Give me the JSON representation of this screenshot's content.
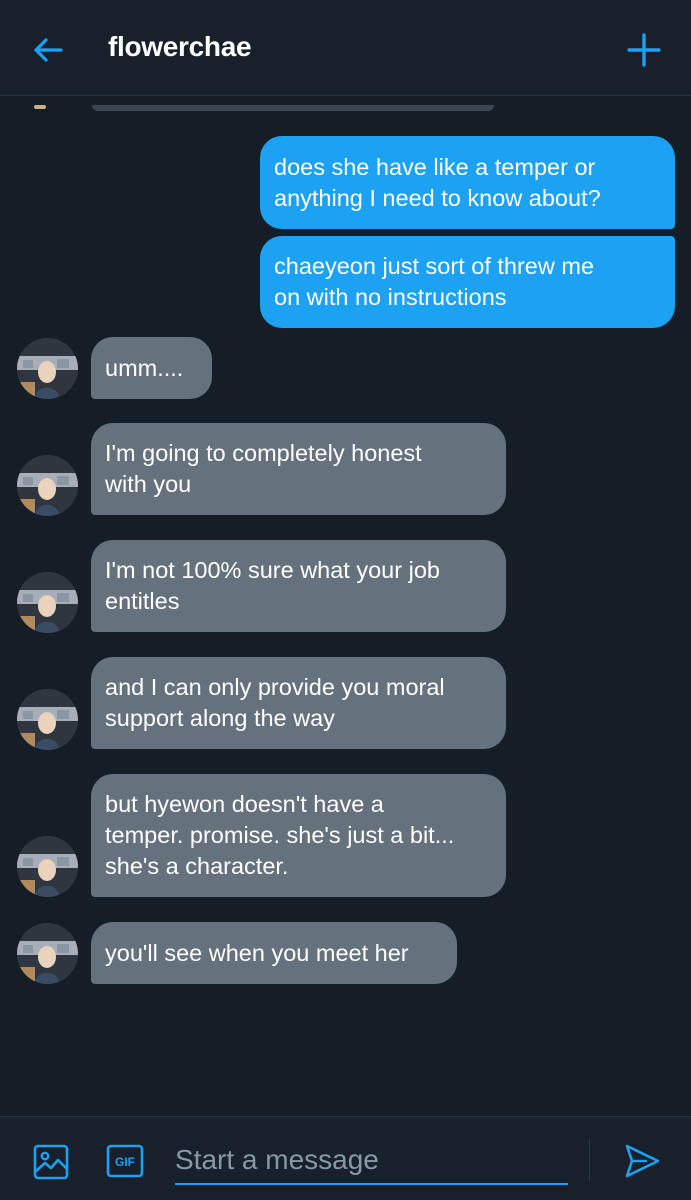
{
  "header": {
    "title": "flowerchae",
    "back_icon": "arrow-left-icon",
    "new_icon": "plus-icon",
    "accent": "#1da1f2"
  },
  "messages": [
    {
      "direction": "sent",
      "text": "does she have like a temper or\nanything I need to know about?"
    },
    {
      "direction": "sent",
      "text": "chaeyeon just sort of threw me\non with no instructions"
    },
    {
      "direction": "received",
      "text": "umm...."
    },
    {
      "direction": "received",
      "text": "I'm going to completely honest\nwith you"
    },
    {
      "direction": "received",
      "text": "I'm not 100% sure what your job\nentitles"
    },
    {
      "direction": "received",
      "text": "and I can only provide you moral\nsupport along the way"
    },
    {
      "direction": "received",
      "text": "but hyewon doesn't have a\ntemper. promise. she's just a bit...\nshe's a character."
    },
    {
      "direction": "received",
      "text": "you'll see when you meet her"
    }
  ],
  "composer": {
    "placeholder": "Start a message",
    "media_icon": "image-icon",
    "gif_icon": "gif-icon",
    "gif_label": "GIF",
    "send_icon": "send-icon"
  },
  "colors": {
    "background": "#151d27",
    "sent_bubble": "#1da1f2",
    "received_bubble": "#66717e",
    "text": "#ffffff",
    "placeholder": "#8899a6"
  }
}
